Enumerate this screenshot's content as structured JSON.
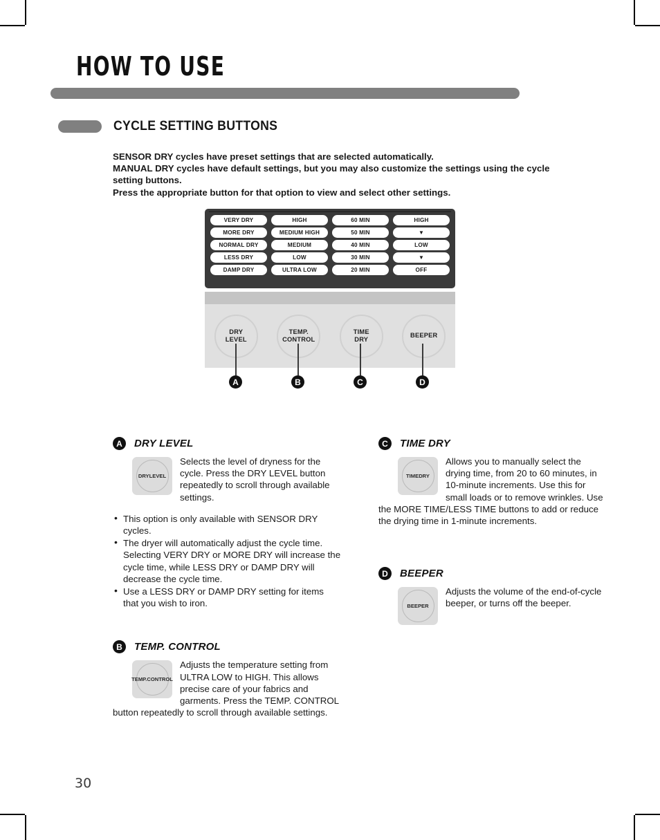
{
  "page": {
    "chapter_title": "HOW TO USE",
    "section_title": "CYCLE SETTING BUTTONS",
    "page_number": "30",
    "accent_gray": "#808080",
    "panel_dark": "#3a3a3a",
    "panel_light": "#e0e0e0"
  },
  "intro": {
    "line1": "SENSOR DRY cycles have preset settings that are selected automatically.",
    "line2": "MANUAL DRY cycles have default settings, but you may also customize the settings using the cycle setting buttons.",
    "line3": "Press the appropriate button for that option to view and select other settings."
  },
  "panel": {
    "columns": [
      {
        "name": "dry-level-options",
        "options": [
          "VERY DRY",
          "MORE DRY",
          "NORMAL DRY",
          "LESS DRY",
          "DAMP DRY"
        ]
      },
      {
        "name": "temp-control-options",
        "options": [
          "HIGH",
          "MEDIUM HIGH",
          "MEDIUM",
          "LOW",
          "ULTRA LOW"
        ]
      },
      {
        "name": "time-dry-options",
        "options": [
          "60 MIN",
          "50 MIN",
          "40 MIN",
          "30 MIN",
          "20 MIN"
        ]
      },
      {
        "name": "beeper-options",
        "options": [
          "HIGH",
          "▼",
          "LOW",
          "▼",
          "OFF"
        ]
      }
    ],
    "knobs": [
      {
        "label_line1": "DRY",
        "label_line2": "LEVEL",
        "marker": "A"
      },
      {
        "label_line1": "TEMP.",
        "label_line2": "CONTROL",
        "marker": "B"
      },
      {
        "label_line1": "TIME",
        "label_line2": "DRY",
        "marker": "C"
      },
      {
        "label_line1": "BEEPER",
        "label_line2": "",
        "marker": "D"
      }
    ]
  },
  "descriptions": {
    "a": {
      "badge": "A",
      "title": "DRY LEVEL",
      "button_line1": "DRY",
      "button_line2": "LEVEL",
      "body": "Selects the level of dryness for the cycle. Press the DRY LEVEL button repeatedly to scroll through available settings.",
      "bullets": [
        "This option is only available with SENSOR DRY cycles.",
        "The dryer will automatically adjust the cycle time. Selecting VERY DRY or MORE DRY will increase the cycle time, while LESS DRY or DAMP DRY will decrease the cycle time.",
        "Use a LESS DRY or DAMP DRY setting for items that you wish to iron."
      ]
    },
    "b": {
      "badge": "B",
      "title": "TEMP. CONTROL",
      "button_line1": "TEMP.",
      "button_line2": "CONTROL",
      "body": "Adjusts the temperature setting from ULTRA LOW to HIGH. This allows precise care of your fabrics and garments. Press the TEMP. CONTROL button repeatedly to scroll through available settings."
    },
    "c": {
      "badge": "C",
      "title": "TIME DRY",
      "button_line1": "TIME",
      "button_line2": "DRY",
      "body": "Allows you to manually select the drying time, from 20 to 60 minutes, in 10-minute increments. Use this for small loads or to remove wrinkles. Use the MORE TIME/LESS TIME buttons to add or reduce the drying time in 1-minute increments."
    },
    "d": {
      "badge": "D",
      "title": "BEEPER",
      "button_line1": "BEEPER",
      "button_line2": "",
      "body": "Adjusts the volume of the end-of-cycle beeper, or turns off the beeper."
    }
  }
}
